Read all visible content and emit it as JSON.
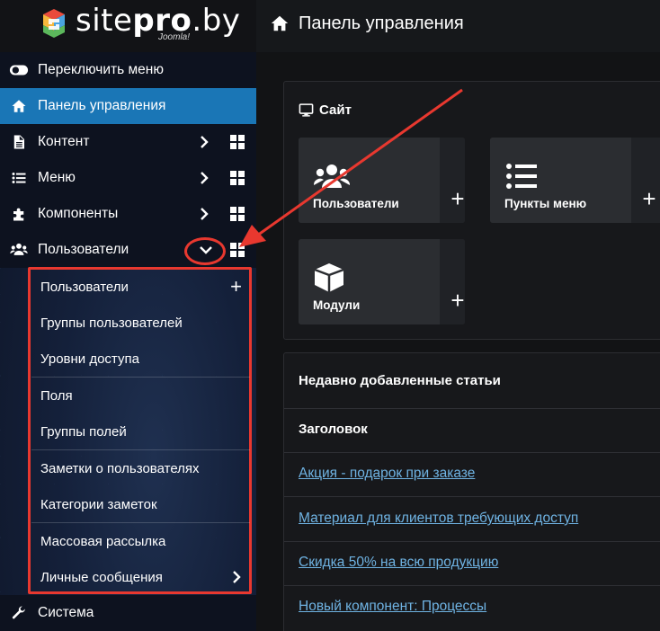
{
  "header": {
    "logo_site": "site",
    "logo_pro": "pro",
    "logo_domain": ".by",
    "logo_sub": "Joomla!",
    "title": "Панель управления"
  },
  "sidebar": {
    "toggle": "Переключить меню",
    "items": [
      {
        "label": "Панель управления",
        "icon": "home-icon"
      },
      {
        "label": "Контент",
        "icon": "file-icon"
      },
      {
        "label": "Меню",
        "icon": "list-icon"
      },
      {
        "label": "Компоненты",
        "icon": "puzzle-icon"
      },
      {
        "label": "Пользователи",
        "icon": "users-icon"
      }
    ],
    "submenu": [
      "Пользователи",
      "Группы пользователей",
      "Уровни доступа",
      "Поля",
      "Группы полей",
      "Заметки о пользователях",
      "Категории заметок",
      "Массовая рассылка",
      "Личные сообщения"
    ],
    "system": "Система"
  },
  "site_card": {
    "title": "Сайт",
    "tiles": [
      {
        "label": "Пользователи",
        "icon": "users-icon"
      },
      {
        "label": "Пункты меню",
        "icon": "list-icon"
      },
      {
        "label": "Модули",
        "icon": "cube-icon"
      }
    ]
  },
  "recent": {
    "title": "Недавно добавленные статьи",
    "column": "Заголовок",
    "articles": [
      "Акция - подарок при заказе",
      "Материал для клиентов требующих доступ",
      "Скидка 50% на всю продукцию",
      "Новый компонент: Процессы"
    ]
  },
  "colors": {
    "accent": "#1a76b6",
    "annotation": "#e8382f",
    "link": "#6fb3e3"
  }
}
